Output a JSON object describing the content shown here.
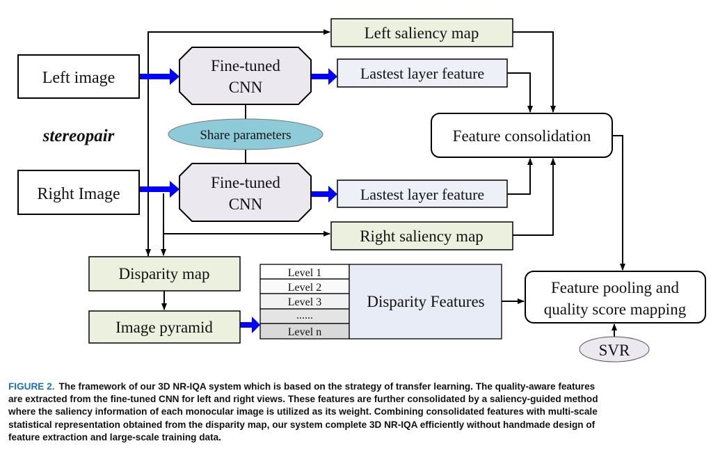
{
  "diagram": {
    "left_image": "Left image",
    "right_image": "Right Image",
    "stereopair": "stereopair",
    "cnn_top": [
      "Fine-tuned",
      "CNN"
    ],
    "cnn_bottom": [
      "Fine-tuned",
      "CNN"
    ],
    "share_parameters": "Share parameters",
    "left_saliency": "Left saliency map",
    "right_saliency": "Right saliency map",
    "latest_top": "Lastest layer feature",
    "latest_bottom": "Lastest layer feature",
    "feature_consolidation": "Feature consolidation",
    "disparity_map": "Disparity map",
    "image_pyramid": "Image pyramid",
    "levels": [
      "Level 1",
      "Level 2",
      "Level 3",
      "......",
      "Level n"
    ],
    "disparity_features": "Disparity Features",
    "pooling": [
      "Feature pooling and",
      "quality score mapping"
    ],
    "svr": "SVR",
    "colors": {
      "green_box": "#ebf1de",
      "cnn": "#ebe8f0",
      "latest": "#eef0f8",
      "ellipse": "#8ecbd9",
      "blue_arrow": "#0000ff",
      "disparity_features": "#e8ecf6"
    }
  },
  "caption": {
    "label": "FIGURE 2.",
    "lines": [
      "The framework of our 3D NR-IQA system which is based on the strategy of transfer learning. The quality-aware features",
      "are extracted from the fine-tuned CNN for left and right views. These features are further consolidated by a saliency-guided method",
      "where the saliency information of each monocular image is utilized as its weight. Combining consolidated features with multi-scale",
      "statistical representation obtained from the disparity map, our system complete 3D NR-IQA efficiently without handmade design of",
      "feature extraction and large-scale training data."
    ]
  }
}
